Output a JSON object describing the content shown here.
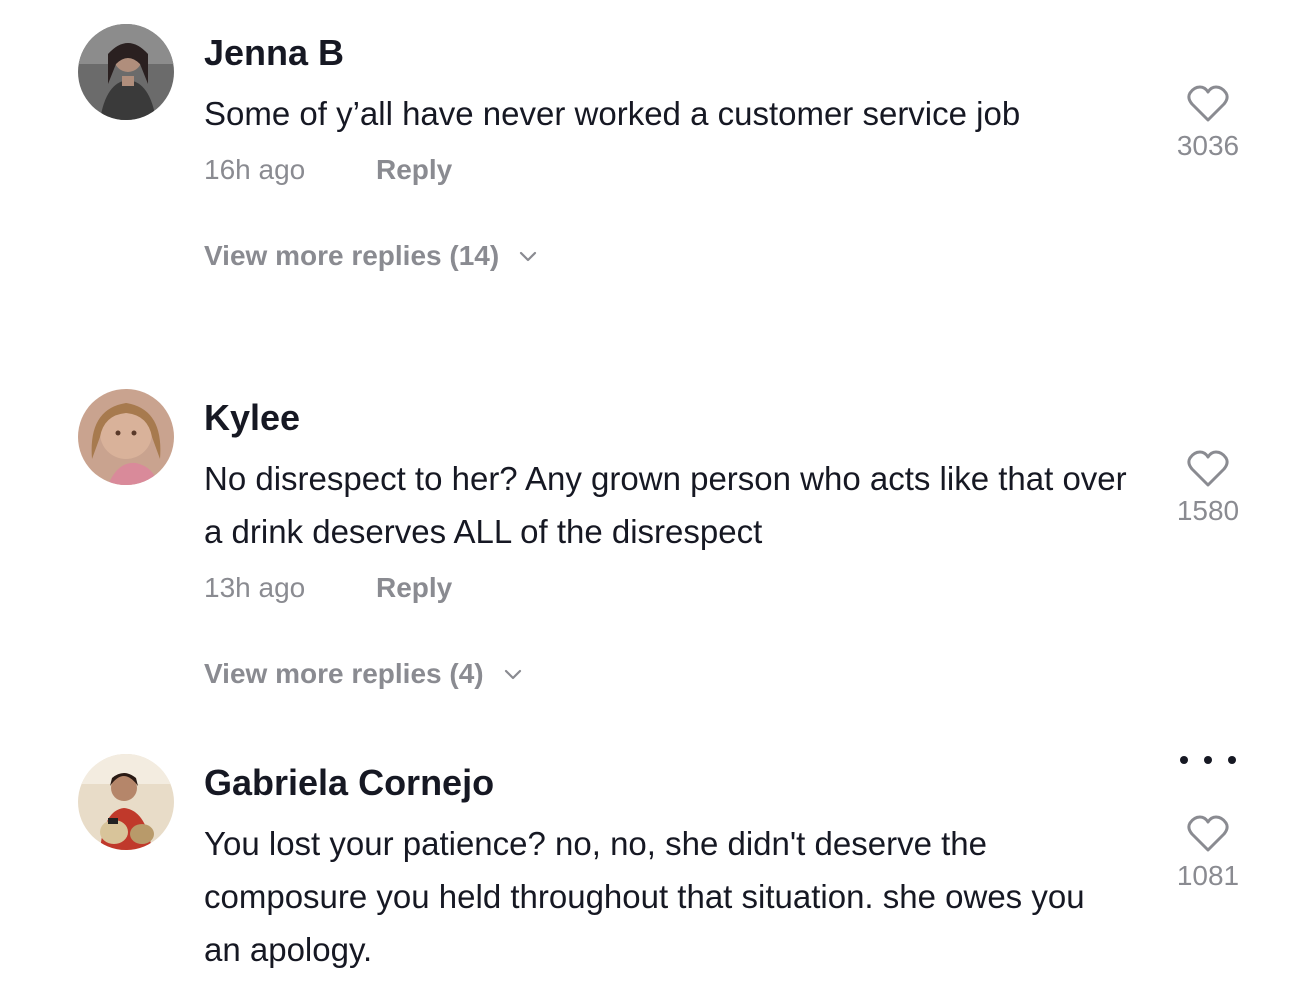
{
  "comments": [
    {
      "username": "Jenna B",
      "text": "Some of y’all have never worked a customer service job",
      "time": "16h ago",
      "reply_label": "Reply",
      "likes": "3036",
      "more_replies": "View more replies (14)"
    },
    {
      "username": "Kylee",
      "text": "No disrespect to her? Any grown person who acts like that over a drink deserves ALL of the disrespect",
      "time": "13h ago",
      "reply_label": "Reply",
      "likes": "1580",
      "more_replies": "View more replies (4)"
    },
    {
      "username": "Gabriela Cornejo",
      "text": "You lost your patience? no, no, she didn't deserve the composure you held throughout that situation. she owes you an apology.",
      "likes": "1081"
    }
  ],
  "icons": {
    "like": "heart-outline-icon",
    "expand": "chevron-down-icon",
    "options": "more-horizontal-icon"
  },
  "colors": {
    "primary_text": "#161823",
    "secondary_text": "#8a8b91"
  }
}
